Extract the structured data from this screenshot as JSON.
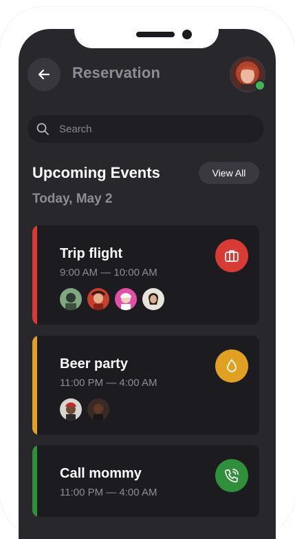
{
  "header": {
    "title": "Reservation",
    "back_icon": "arrow-left-icon",
    "online_color": "#3fb655"
  },
  "search": {
    "placeholder": "Search",
    "icon": "search-icon"
  },
  "section": {
    "title": "Upcoming Events",
    "view_all_label": "View All",
    "date": "Today, May 2"
  },
  "events": [
    {
      "title": "Trip flight",
      "time": "9:00 AM — 10:00 AM",
      "accent": "#d83b33",
      "icon": "briefcase-icon",
      "attendee_count": 4
    },
    {
      "title": "Beer party",
      "time": "11:00 PM — 4:00 AM",
      "accent": "#e0a020",
      "icon": "drop-icon",
      "attendee_count": 2
    },
    {
      "title": "Call mommy",
      "time": "11:00 PM — 4:00 AM",
      "accent": "#2f8f3a",
      "icon": "phone-call-icon",
      "attendee_count": 0
    }
  ]
}
